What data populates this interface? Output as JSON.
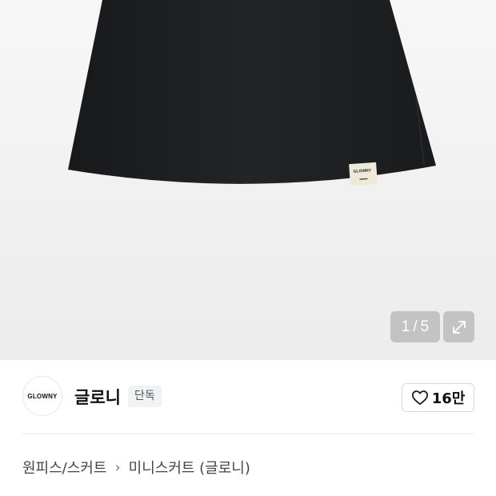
{
  "gallery": {
    "current_page": "1",
    "separator": "/",
    "total_pages": "5",
    "icons": {
      "expand": "expand-icon"
    },
    "product_label_text": "GLOWNY"
  },
  "brand": {
    "logo_text": "GLOWNY",
    "name": "글로니",
    "badge": "단독",
    "like_count": "16만",
    "icons": {
      "like": "heart-outline-icon"
    }
  },
  "breadcrumb": {
    "items": [
      "원피스/스커트",
      "미니스커트 (글로니)"
    ],
    "separator_icon": "chevron-right-icon"
  },
  "colors": {
    "skirt": "#1e1f21",
    "gallery_bg": "#f0f0f0",
    "badge_bg": "#f1f2f4",
    "overlay_btn": "#a0a0a0"
  }
}
